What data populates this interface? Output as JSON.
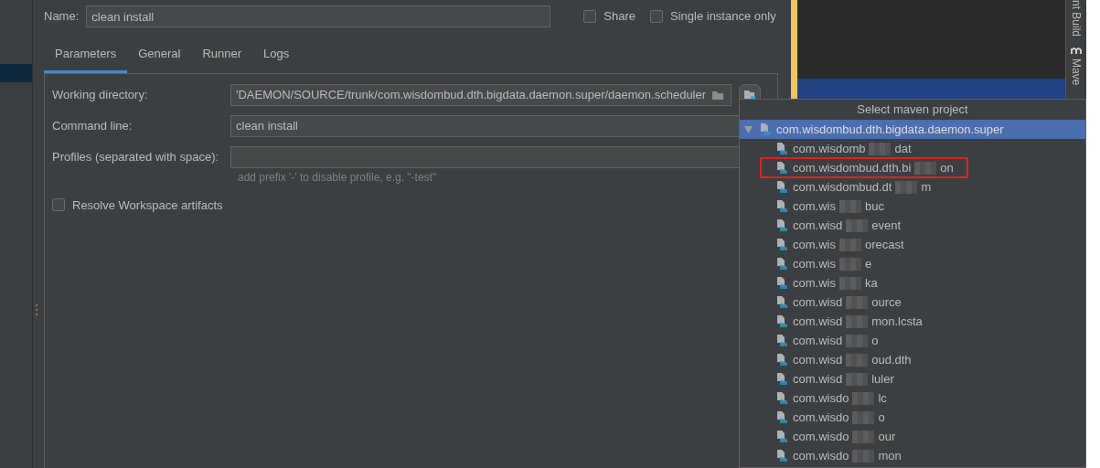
{
  "name_field": {
    "label": "Name:",
    "value": "clean install"
  },
  "options": [
    {
      "label": "Share",
      "checked": false
    },
    {
      "label": "Single instance only",
      "checked": false
    }
  ],
  "tabs": [
    {
      "label": "Parameters",
      "selected": true
    },
    {
      "label": "General",
      "selected": false
    },
    {
      "label": "Runner",
      "selected": false
    },
    {
      "label": "Logs",
      "selected": false
    }
  ],
  "fields": [
    {
      "label": "Working directory:",
      "value": "'DAEMON/SOURCE/trunk/com.wisdombud.dth.bigdata.daemon.super/daemon.scheduler",
      "kind": "path"
    },
    {
      "label": "Command line:",
      "value": "clean install",
      "kind": "text"
    },
    {
      "label": "Profiles (separated with space):",
      "kind": "text",
      "hint": "add prefix '-' to disable profile, e.g. \"-test\""
    }
  ],
  "resolve_workspace": {
    "label": "Resolve Workspace artifacts",
    "checked": false
  },
  "tool_window_stripe": [
    "nt Build",
    "Mave"
  ],
  "popup": {
    "title": "Select maven project",
    "root": {
      "label": "com.wisdombud.dth.bigdata.daemon.super",
      "expanded": true,
      "selected": true,
      "children": [
        {
          "prefix": "com.wisdomb",
          "suffix": "dat",
          "highlighted": false
        },
        {
          "prefix": "com.wisdombud.dth.bi",
          "suffix": "on",
          "highlighted": true
        },
        {
          "prefix": "com.wisdombud.dt",
          "suffix": "m",
          "highlighted": false
        },
        {
          "prefix": "com.wis",
          "suffix": "buc",
          "highlighted": false
        },
        {
          "prefix": "com.wisd",
          "suffix": "event",
          "highlighted": false
        },
        {
          "prefix": "com.wis",
          "suffix": "orecast",
          "highlighted": false
        },
        {
          "prefix": "com.wis",
          "suffix": "e",
          "highlighted": false
        },
        {
          "prefix": "com.wis",
          "suffix": "ka",
          "highlighted": false
        },
        {
          "prefix": "com.wisd",
          "suffix": "ource",
          "highlighted": false
        },
        {
          "prefix": "com.wisd",
          "suffix": "mon.lcsta",
          "highlighted": false
        },
        {
          "prefix": "com.wisd",
          "suffix": "o",
          "highlighted": false
        },
        {
          "prefix": "com.wisd",
          "suffix": "oud.dth",
          "highlighted": false
        },
        {
          "prefix": "com.wisd",
          "suffix": "luler",
          "highlighted": false
        },
        {
          "prefix": "com.wisdo",
          "suffix": "lc",
          "highlighted": false
        },
        {
          "prefix": "com.wisdo",
          "suffix": "o",
          "highlighted": false
        },
        {
          "prefix": "com.wisdo",
          "suffix": "our",
          "highlighted": false
        },
        {
          "prefix": "com.wisdo",
          "suffix": "mon",
          "highlighted": false
        }
      ]
    }
  }
}
